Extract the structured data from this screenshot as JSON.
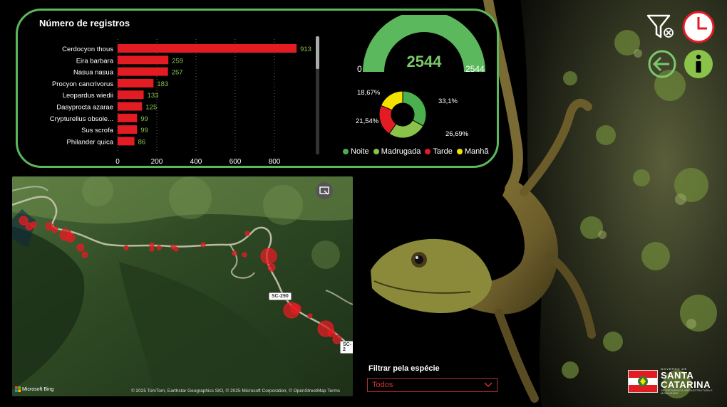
{
  "card": {
    "title": "Número de registros"
  },
  "chart_data": [
    {
      "type": "bar",
      "orientation": "horizontal",
      "title": "Número de registros",
      "categories": [
        "Cerdocyon thous",
        "Eira barbara",
        "Nasua nasua",
        "Procyon cancrivorus",
        "Leopardus wiedii",
        "Dasyprocta azarae",
        "Crypturellus obsole...",
        "Sus scrofa",
        "Philander quica"
      ],
      "values": [
        913,
        259,
        257,
        183,
        133,
        125,
        99,
        99,
        86
      ],
      "xlim": [
        0,
        1000
      ],
      "xticks": [
        0,
        200,
        400,
        600,
        800
      ],
      "grid": "vertical-dotted",
      "bar_color": "#e31c23",
      "label_color": "#8bc34a"
    },
    {
      "type": "gauge",
      "value": 2544,
      "min": 0,
      "max": 2544,
      "fill_color": "#5cb85c"
    },
    {
      "type": "pie",
      "variant": "donut",
      "categories": [
        "Noite",
        "Madrugada",
        "Tarde",
        "Manhã"
      ],
      "values": [
        33.1,
        26.69,
        21.54,
        18.67
      ],
      "labels": [
        "33,1%",
        "26,69%",
        "21,54%",
        "18,67%"
      ],
      "colors": [
        "#4caf50",
        "#8bc34a",
        "#e31c23",
        "#f5e100"
      ],
      "legend": "bottom"
    }
  ],
  "gauge": {
    "value_label": "2544",
    "min_label": "0",
    "max_label": "2544"
  },
  "donut": {
    "legend": [
      {
        "label": "Noite",
        "color": "#4caf50"
      },
      {
        "label": "Madrugada",
        "color": "#8bc34a"
      },
      {
        "label": "Tarde",
        "color": "#e31c23"
      },
      {
        "label": "Manhã",
        "color": "#f5e100"
      }
    ]
  },
  "map": {
    "road_labels": [
      "SC-290",
      "SC-2"
    ],
    "bing_label": "Microsoft Bing",
    "attribution": "© 2025 TomTom, Earthstar Geographics SIO, © 2025 Microsoft Corporation, © OpenStreetMap  Terms",
    "point_color": "#e31c23"
  },
  "filter": {
    "label": "Filtrar pela espécie",
    "value": "Todos"
  },
  "logo": {
    "gov": "GOVERNO DE",
    "santa": "SANTA",
    "catarina": "CATARINA",
    "sub": "SECRETARIA DA INFRAESTRUTURA E MOBILIDADE"
  },
  "colors": {
    "accent_green": "#5cb85c",
    "light_green": "#8bc34a",
    "red": "#e31c23",
    "yellow": "#f5e100"
  }
}
